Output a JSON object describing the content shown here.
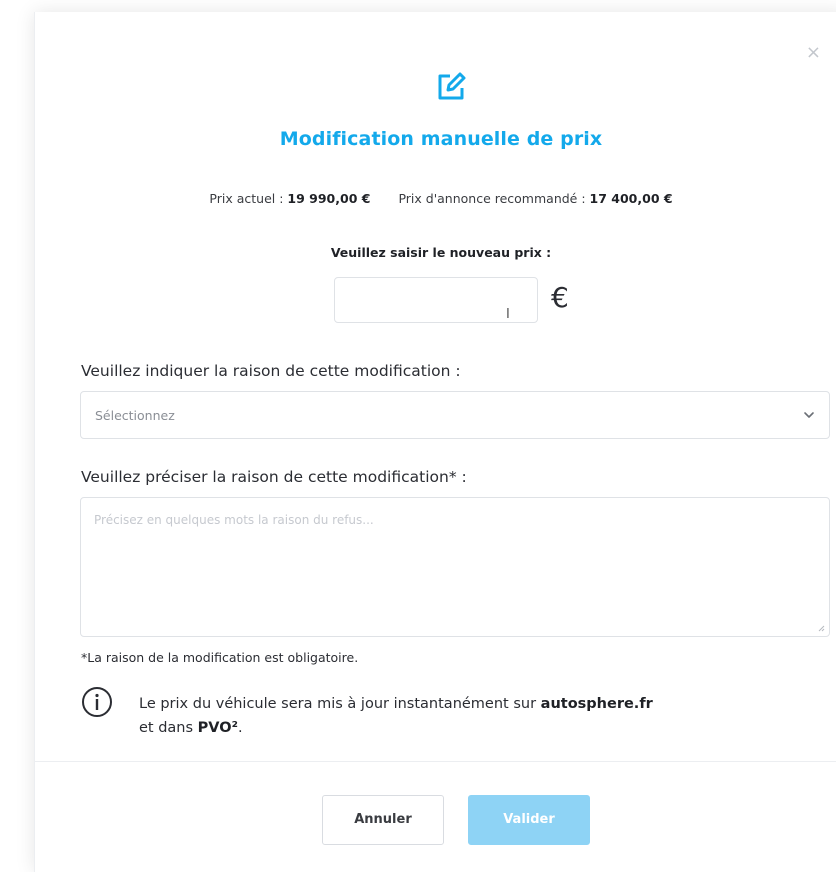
{
  "modal": {
    "close_symbol": "×",
    "title": "Modification manuelle de prix",
    "prices": {
      "current_label": "Prix actuel : ",
      "current_value": "19 990,00 €",
      "recommended_label": "Prix d'annonce recommandé : ",
      "recommended_value": "17 400,00 €"
    },
    "new_price": {
      "label": "Veuillez saisir le nouveau prix :",
      "value": "",
      "currency": "€"
    },
    "reason": {
      "label": "Veuillez indiquer la raison de cette modification :",
      "placeholder": "Sélectionnez"
    },
    "detail": {
      "label": "Veuillez préciser la raison de cette modification* :",
      "placeholder": "Précisez en quelques mots la raison du refus..."
    },
    "required_note": "*La raison de la modification est obligatoire.",
    "info": {
      "text_1": "Le prix du véhicule sera mis à jour instantanément sur ",
      "site": "autosphere.fr",
      "text_2": "et dans ",
      "system": "PVO²",
      "text_3": "."
    },
    "buttons": {
      "cancel": "Annuler",
      "validate": "Valider"
    }
  },
  "colors": {
    "accent": "#13a9eb",
    "validate_button_disabled": "#8ed3f5",
    "border": "#dfe2e6"
  },
  "icons": [
    "edit-icon",
    "close-icon",
    "chevron-down-icon",
    "info-icon",
    "resize-grip-icon",
    "text-cursor-icon"
  ]
}
